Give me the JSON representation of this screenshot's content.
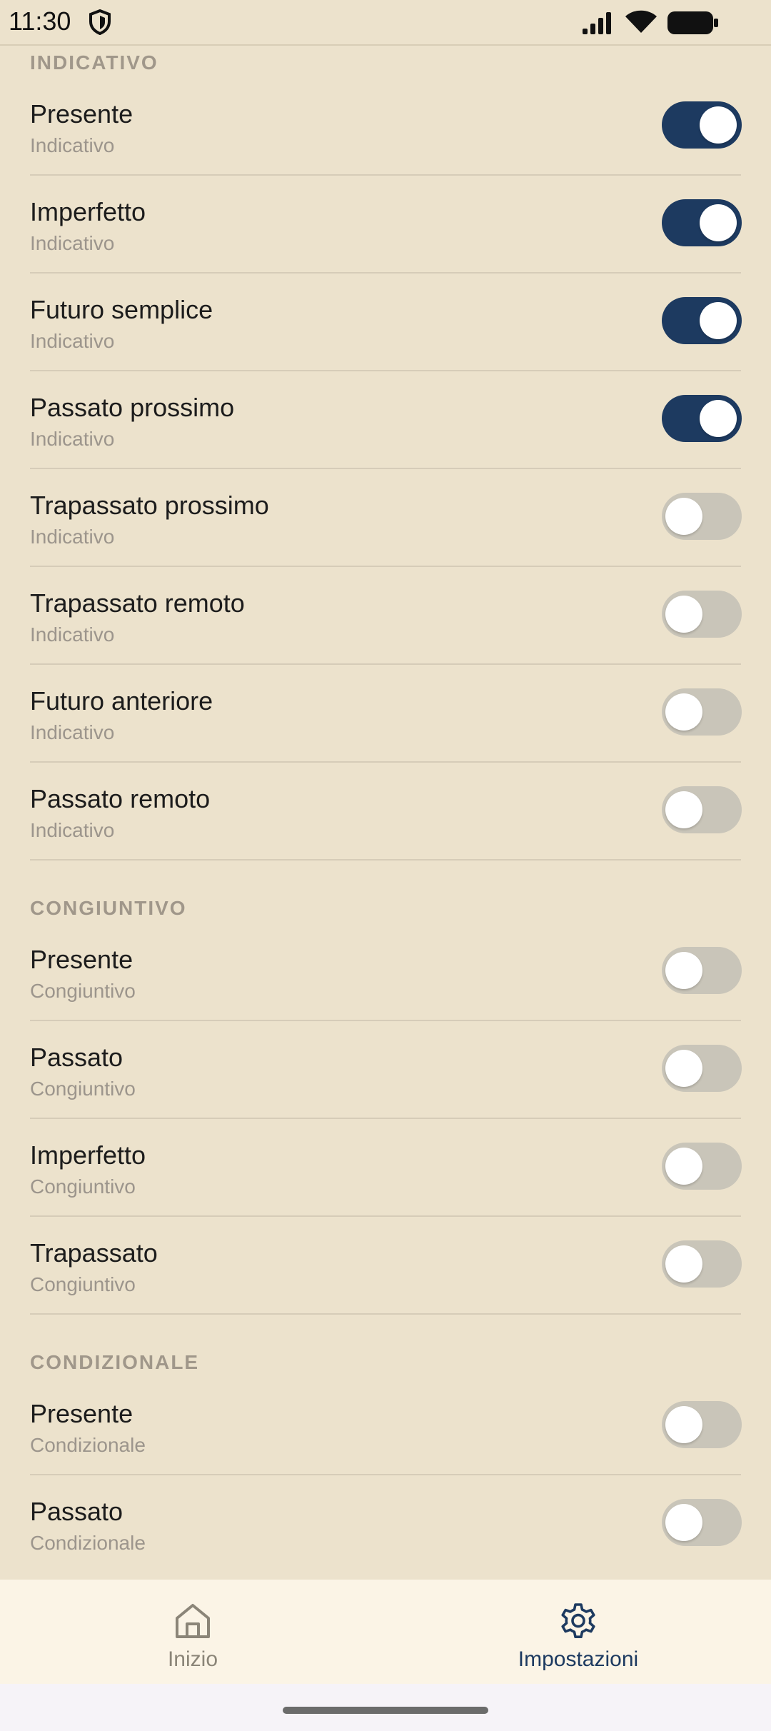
{
  "status_bar": {
    "time": "11:30"
  },
  "sections": [
    {
      "title": "INDICATIVO",
      "items": [
        {
          "title": "Presente",
          "subtitle": "Indicativo",
          "enabled": true
        },
        {
          "title": "Imperfetto",
          "subtitle": "Indicativo",
          "enabled": true
        },
        {
          "title": "Futuro semplice",
          "subtitle": "Indicativo",
          "enabled": true
        },
        {
          "title": "Passato prossimo",
          "subtitle": "Indicativo",
          "enabled": true
        },
        {
          "title": "Trapassato prossimo",
          "subtitle": "Indicativo",
          "enabled": false
        },
        {
          "title": "Trapassato remoto",
          "subtitle": "Indicativo",
          "enabled": false
        },
        {
          "title": "Futuro anteriore",
          "subtitle": "Indicativo",
          "enabled": false
        },
        {
          "title": "Passato remoto",
          "subtitle": "Indicativo",
          "enabled": false
        }
      ]
    },
    {
      "title": "CONGIUNTIVO",
      "items": [
        {
          "title": "Presente",
          "subtitle": "Congiuntivo",
          "enabled": false
        },
        {
          "title": "Passato",
          "subtitle": "Congiuntivo",
          "enabled": false
        },
        {
          "title": "Imperfetto",
          "subtitle": "Congiuntivo",
          "enabled": false
        },
        {
          "title": "Trapassato",
          "subtitle": "Congiuntivo",
          "enabled": false
        }
      ]
    },
    {
      "title": "CONDIZIONALE",
      "items": [
        {
          "title": "Presente",
          "subtitle": "Condizionale",
          "enabled": false
        },
        {
          "title": "Passato",
          "subtitle": "Condizionale",
          "enabled": false
        }
      ]
    }
  ],
  "bottom_nav": {
    "home": {
      "label": "Inizio",
      "icon": "home-icon",
      "active": false
    },
    "settings": {
      "label": "Impostazioni",
      "icon": "gear-icon",
      "active": true
    }
  },
  "colors": {
    "background": "#ece2cc",
    "toggle_on": "#1d3a60",
    "toggle_off": "#c9c5b9",
    "nav_background": "#fbf4e6",
    "active_nav": "#1d3a60"
  }
}
